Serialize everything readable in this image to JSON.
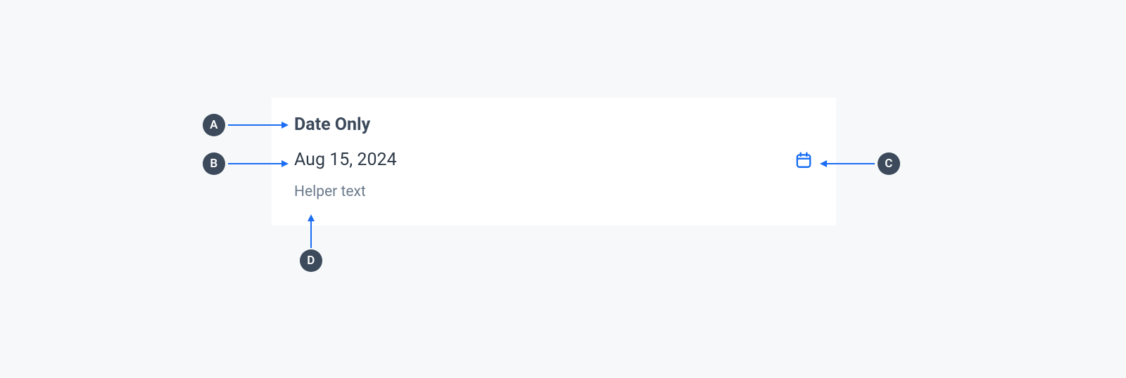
{
  "datepicker": {
    "label": "Date Only",
    "value": "Aug 15, 2024",
    "helper": "Helper text",
    "icon_name": "calendar-icon"
  },
  "callouts": {
    "a": "A",
    "b": "B",
    "c": "C",
    "d": "D"
  },
  "colors": {
    "accent": "#1b6ef3",
    "badge": "#3c4a5b",
    "card_bg": "#ffffff",
    "page_bg": "#f6f8fa",
    "text_primary": "#2e3a48",
    "text_label": "#3c4a5b",
    "text_helper": "#6b7a8c"
  }
}
